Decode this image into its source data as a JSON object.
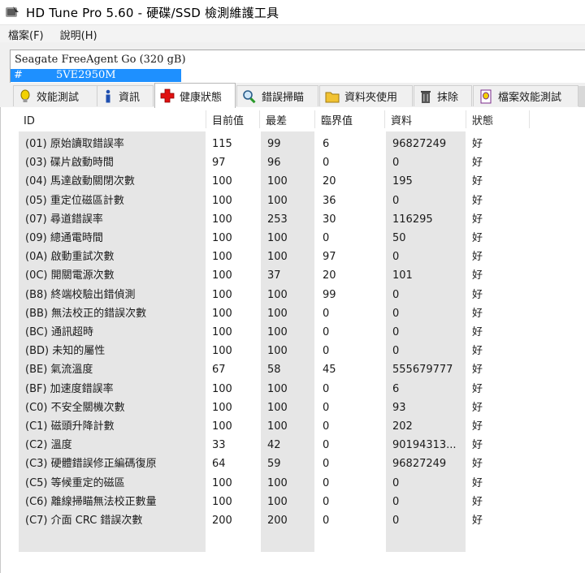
{
  "window": {
    "title": "HD Tune Pro 5.60 - 硬碟/SSD 檢測維護工具"
  },
  "menu": {
    "items": [
      "檔案(F)",
      "說明(H)"
    ]
  },
  "drive": {
    "name": "Seagate FreeAgent Go    (320 gB)",
    "serial_prefix": "#",
    "serial": "5VE2950M"
  },
  "tabs": [
    {
      "label": "效能測試",
      "icon": "bulb-icon"
    },
    {
      "label": "資訊",
      "icon": "info-icon"
    },
    {
      "label": "健康狀態",
      "icon": "red-cross-icon",
      "active": true
    },
    {
      "label": "錯誤掃瞄",
      "icon": "magnifier-icon"
    },
    {
      "label": "資料夾使用",
      "icon": "folder-icon"
    },
    {
      "label": "抹除",
      "icon": "trash-icon"
    },
    {
      "label": "檔案效能測試",
      "icon": "file-benchmark-icon"
    }
  ],
  "table": {
    "columns": [
      "ID",
      "目前值",
      "最差",
      "臨界值",
      "資料",
      "狀態"
    ],
    "rows": [
      [
        "(01) 原始讀取錯誤率",
        "115",
        "99",
        "6",
        "96827249",
        "好"
      ],
      [
        "(03) 碟片啟動時間",
        "97",
        "96",
        "0",
        "0",
        "好"
      ],
      [
        "(04) 馬達啟動關閉次數",
        "100",
        "100",
        "20",
        "195",
        "好"
      ],
      [
        "(05) 重定位磁區計數",
        "100",
        "100",
        "36",
        "0",
        "好"
      ],
      [
        "(07) 尋道錯誤率",
        "100",
        "253",
        "30",
        "116295",
        "好"
      ],
      [
        "(09) 總通電時間",
        "100",
        "100",
        "0",
        "50",
        "好"
      ],
      [
        "(0A) 啟動重試次數",
        "100",
        "100",
        "97",
        "0",
        "好"
      ],
      [
        "(0C) 開關電源次數",
        "100",
        "37",
        "20",
        "101",
        "好"
      ],
      [
        "(B8) 終端校驗出錯偵測",
        "100",
        "100",
        "99",
        "0",
        "好"
      ],
      [
        "(BB) 無法校正的錯誤次數",
        "100",
        "100",
        "0",
        "0",
        "好"
      ],
      [
        "(BC) 通訊超時",
        "100",
        "100",
        "0",
        "0",
        "好"
      ],
      [
        "(BD) 未知的屬性",
        "100",
        "100",
        "0",
        "0",
        "好"
      ],
      [
        "(BE) 氣流溫度",
        "67",
        "58",
        "45",
        "555679777",
        "好"
      ],
      [
        "(BF) 加速度錯誤率",
        "100",
        "100",
        "0",
        "6",
        "好"
      ],
      [
        "(C0) 不安全關機次數",
        "100",
        "100",
        "0",
        "93",
        "好"
      ],
      [
        "(C1) 磁頭升降計數",
        "100",
        "100",
        "0",
        "202",
        "好"
      ],
      [
        "(C2) 溫度",
        "33",
        "42",
        "0",
        "90194313...",
        "好"
      ],
      [
        "(C3) 硬體錯誤修正編碼復原",
        "64",
        "59",
        "0",
        "96827249",
        "好"
      ],
      [
        "(C5) 等候重定的磁區",
        "100",
        "100",
        "0",
        "0",
        "好"
      ],
      [
        "(C6) 離線掃瞄無法校正數量",
        "100",
        "100",
        "0",
        "0",
        "好"
      ],
      [
        "(C7) 介面 CRC 錯誤次數",
        "200",
        "200",
        "0",
        "0",
        "好"
      ]
    ]
  }
}
